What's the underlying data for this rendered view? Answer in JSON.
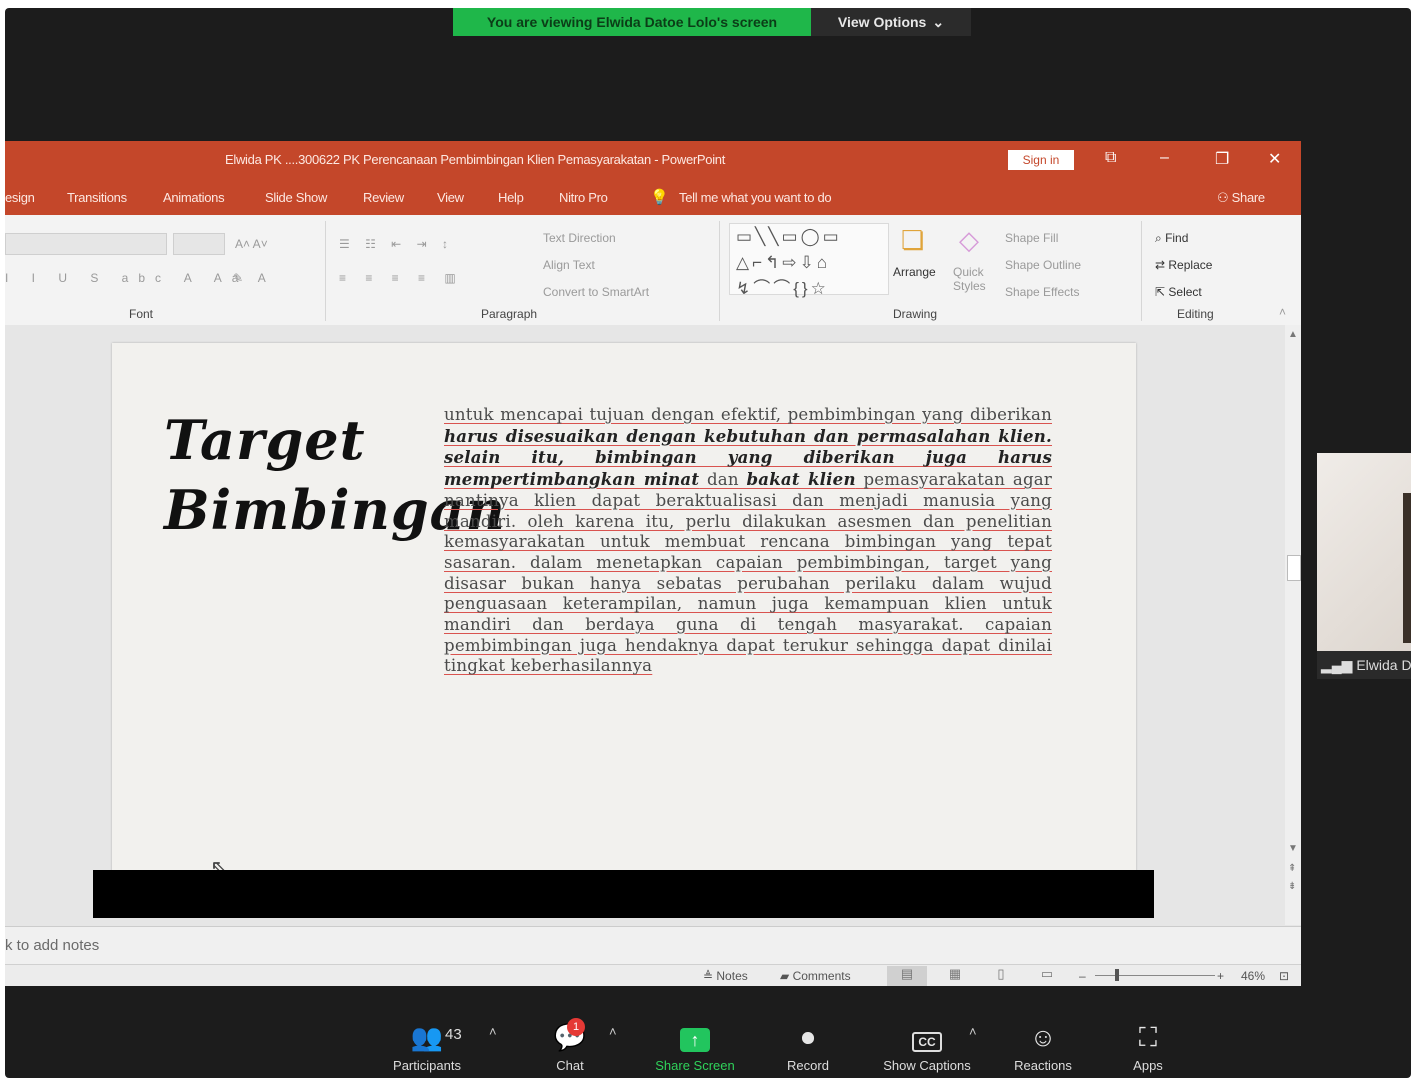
{
  "zoom": {
    "banner_text": "You are viewing Elwida Datoe Lolo's screen",
    "view_options_label": "View Options",
    "participant_thumb_name": "Elwida D",
    "toolbar": {
      "participants_label": "Participants",
      "participants_count": "43",
      "chat_label": "Chat",
      "chat_badge": "1",
      "share_label": "Share Screen",
      "record_label": "Record",
      "captions_label": "Show Captions",
      "captions_icon_text": "CC",
      "reactions_label": "Reactions",
      "apps_label": "Apps"
    }
  },
  "powerpoint": {
    "window_title": "Elwida PK ....300622 PK Perencanaan Pembimbingan Klien Pemasyarakatan - PowerPoint",
    "sign_in_label": "Sign in",
    "menu_tabs": [
      "esign",
      "Transitions",
      "Animations",
      "Slide Show",
      "Review",
      "View",
      "Help",
      "Nitro Pro"
    ],
    "tell_me": "Tell me what you want to do",
    "share_label": "Share",
    "ribbon": {
      "groups": [
        "Font",
        "Paragraph",
        "Drawing",
        "Editing"
      ],
      "text_direction": "Text Direction",
      "align_text": "Align Text",
      "convert_smartart": "Convert to SmartArt",
      "arrange": "Arrange",
      "quick_styles": "Quick Styles",
      "shape_fill": "Shape Fill",
      "shape_outline": "Shape Outline",
      "shape_effects": "Shape Effects",
      "find": "Find",
      "replace": "Replace",
      "select": "Select"
    },
    "slide": {
      "title_line1": "Target",
      "title_line2": "Bimbingan",
      "body_part1": "untuk mencapai tujuan dengan efektif, pembimbingan yang diberikan ",
      "body_emph1": "harus disesuaikan dengan kebutuhan dan permasalahan klien. selain itu, bimbingan yang diberikan juga harus mempertimbangkan minat",
      "body_part2": " dan ",
      "body_emph2": "bakat klien",
      "body_part3": " pemasyarakatan agar nantinya klien dapat beraktualisasi dan menjadi manusia yang mandiri. oleh karena itu, perlu dilakukan asesmen dan penelitian kemasyarakatan untuk membuat rencana bimbingan yang tepat sasaran. dalam menetapkan capaian pembimbingan, target yang disasar bukan hanya sebatas perubahan perilaku dalam wujud penguasaan keterampilan, namun juga kemampuan klien untuk mandiri dan berdaya guna di tengah masyarakat. capaian pembimbingan juga hendaknya dapat terukur sehingga dapat dinilai tingkat keberhasilannya"
    },
    "notes_placeholder": "k to add notes",
    "status": {
      "notes_label": "Notes",
      "comments_label": "Comments",
      "zoom_level": "46%"
    }
  }
}
